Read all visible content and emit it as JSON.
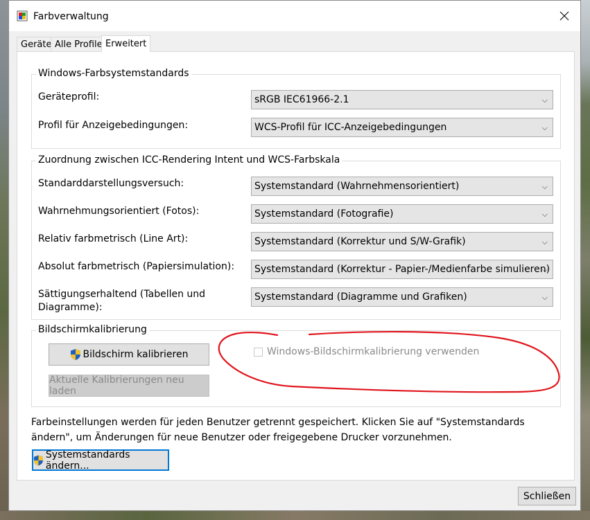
{
  "window": {
    "title": "Farbverwaltung"
  },
  "tabs": [
    {
      "label": "Geräte"
    },
    {
      "label": "Alle Profile"
    },
    {
      "label": "Erweitert"
    }
  ],
  "windows_standards": {
    "title": "Windows-Farbsystemstandards",
    "device_profile_label": "Geräteprofil:",
    "device_profile_value": "sRGB IEC61966-2.1",
    "viewing_conditions_label": "Profil für Anzeigebedingungen:",
    "viewing_conditions_value": "WCS-Profil für ICC-Anzeigebedingungen"
  },
  "mapping": {
    "title": "Zuordnung zwischen ICC-Rendering Intent und WCS-Farbskala",
    "rows": [
      {
        "label": "Standarddarstellungsversuch:",
        "value": "Systemstandard (Wahrnehmensorientiert)"
      },
      {
        "label": "Wahrnehmungsorientiert (Fotos):",
        "value": "Systemstandard (Fotografie)"
      },
      {
        "label": "Relativ farbmetrisch (Line Art):",
        "value": "Systemstandard (Korrektur und S/W-Grafik)"
      },
      {
        "label": "Absolut farbmetrisch (Papiersimulation):",
        "value": "Systemstandard (Korrektur - Papier-/Medienfarbe simulieren)"
      },
      {
        "label_line1": "Sättigungserhaltend (Tabellen und",
        "label_line2": "Diagramme):",
        "value": "Systemstandard (Diagramme und Grafiken)"
      }
    ]
  },
  "calibration": {
    "title": "Bildschirmkalibrierung",
    "calibrate_button": "Bildschirm kalibrieren",
    "reload_button": "Aktuelle Kalibrierungen neu laden",
    "use_windows_calibration": "Windows-Bildschirmkalibrierung verwenden"
  },
  "info_text": "Farbeinstellungen werden für jeden Benutzer getrennt gespeichert. Klicken Sie auf \"Systemstandards ändern\", um Änderungen für neue Benutzer oder freigegebene Drucker vorzunehmen.",
  "change_defaults_button": "Systemstandards ändern...",
  "close_button": "Schließen",
  "colors": {
    "annotation": "#e0141c",
    "focus": "#0078d7",
    "shield_blue": "#1f5fbf",
    "shield_yellow": "#f2c12e"
  }
}
